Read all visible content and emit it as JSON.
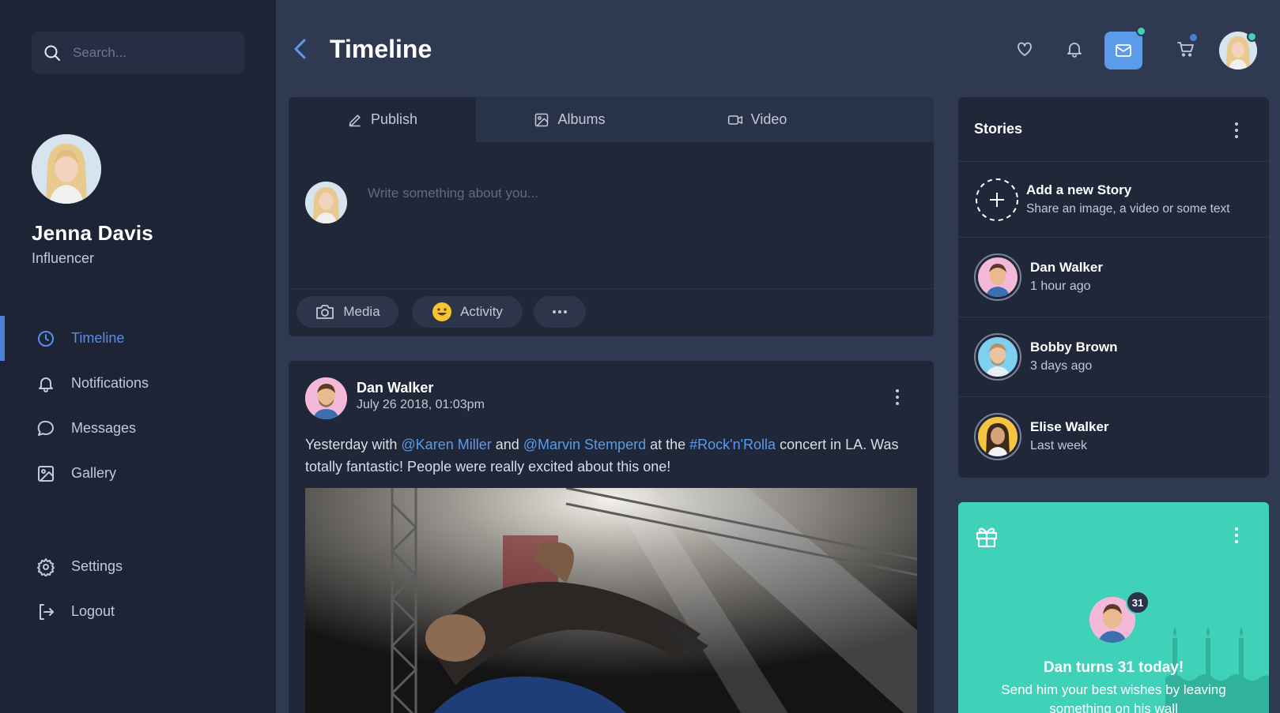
{
  "search": {
    "placeholder": "Search..."
  },
  "profile": {
    "name": "Jenna Davis",
    "role": "Influencer"
  },
  "sidebar": {
    "items": [
      {
        "label": "Timeline",
        "icon": "clock-icon",
        "active": true
      },
      {
        "label": "Notifications",
        "icon": "bell-icon"
      },
      {
        "label": "Messages",
        "icon": "chat-icon"
      },
      {
        "label": "Gallery",
        "icon": "image-icon"
      }
    ],
    "bottom": [
      {
        "label": "Settings",
        "icon": "gear-icon"
      },
      {
        "label": "Logout",
        "icon": "logout-icon"
      }
    ]
  },
  "header": {
    "title": "Timeline",
    "icons": [
      "heart-icon",
      "bell-icon",
      "mail-icon",
      "cart-icon"
    ]
  },
  "composer": {
    "tabs": [
      {
        "label": "Publish",
        "icon": "pencil-icon"
      },
      {
        "label": "Albums",
        "icon": "image-icon"
      },
      {
        "label": "Video",
        "icon": "video-icon"
      }
    ],
    "placeholder": "Write something about you...",
    "actions": {
      "media": "Media",
      "activity": "Activity"
    }
  },
  "post": {
    "author": "Dan Walker",
    "date": "July 26 2018, 01:03pm",
    "text": {
      "p1": "Yesterday with ",
      "mention1": "@Karen Miller",
      "p2": " and ",
      "mention2": "@Marvin Stemperd",
      "p3": " at the ",
      "tag": "#Rock'n'Rolla",
      "p4": " concert in LA. Was totally fantastic! People were really excited about this one!"
    }
  },
  "stories": {
    "title": "Stories",
    "add": {
      "title": "Add a new Story",
      "subtitle": "Share an image, a video or some text"
    },
    "items": [
      {
        "name": "Dan Walker",
        "time": "1 hour ago"
      },
      {
        "name": "Bobby Brown",
        "time": "3 days ago"
      },
      {
        "name": "Elise Walker",
        "time": "Last week"
      }
    ]
  },
  "birthday": {
    "badge": "31",
    "title": "Dan turns 31 today!",
    "text": "Send him your best wishes by leaving something on his wall"
  },
  "colors": {
    "accent": "#5b9bea",
    "teal": "#40d1b9",
    "sidebar_bg": "#1c2435",
    "page_bg": "#2f3a52",
    "card_bg": "#1f2739"
  }
}
